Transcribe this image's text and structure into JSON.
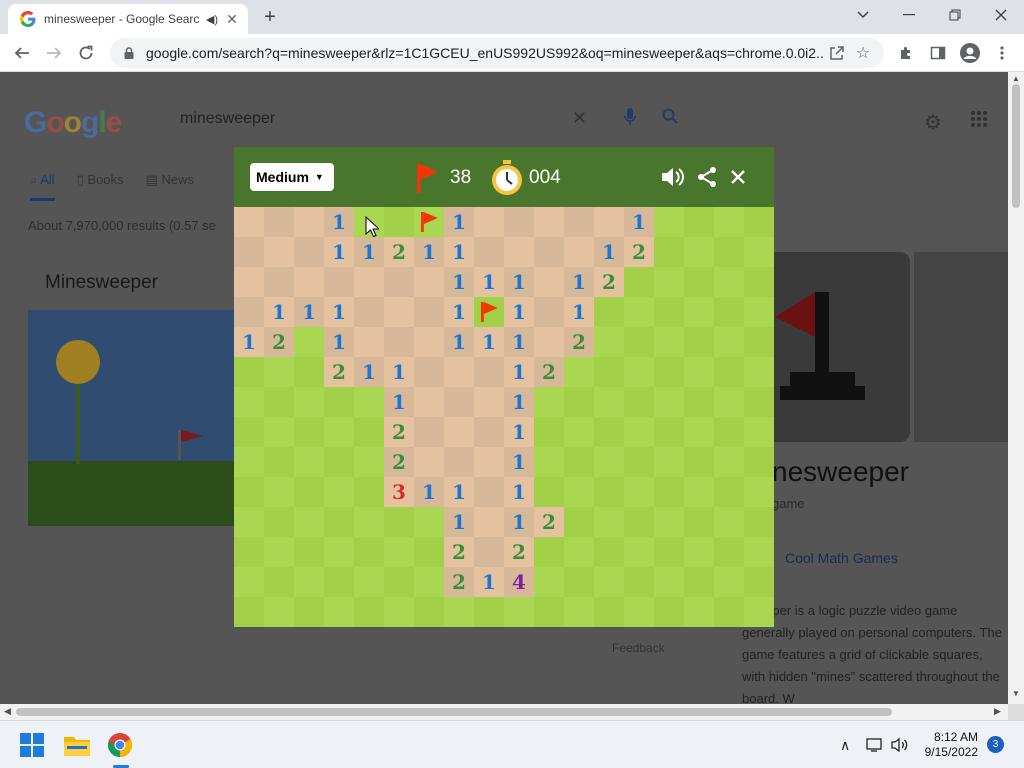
{
  "browser": {
    "tab_title": "minesweeper - Google Search",
    "url": "google.com/search?q=minesweeper&rlz=1C1GCEU_enUS992US992&oq=minesweeper&aqs=chrome.0.0i2..."
  },
  "google": {
    "query": "minesweeper",
    "tabs": [
      {
        "label": "All"
      },
      {
        "label": "Books"
      },
      {
        "label": "News"
      }
    ],
    "stats": "About 7,970,000 results (0.57 se",
    "heading": "Minesweeper",
    "kp_title": "nesweeper",
    "kp_subtitle": "game",
    "kp_link": "Cool Math Games",
    "kp_desc": "sweeper is a logic puzzle video game generally played on personal computers. The game features a grid of clickable squares, with hidden \"mines\" scattered throughout the board. W",
    "feedback": "Feedback"
  },
  "game": {
    "difficulty": "Medium",
    "flags_remaining": "38",
    "timer": "004",
    "cols": 18,
    "rows": 14,
    "colors": {
      "header": "#4a752c",
      "hidden_light": "#aad751",
      "hidden_dark": "#a2d149",
      "revealed_light": "#e5c29f",
      "revealed_dark": "#d7b899",
      "flag": "#f23607"
    },
    "board": [
      "RRR1HHF1RRRRR1HHHH",
      "RRR11211RRRR12HHHH",
      "RRRRRRR111R12HHHHH",
      "R111RRR1F1R1HHHHHH",
      "12H1RRR111R2HHHHHH",
      "HHH211RRR12HHHHHHH",
      "HHHHH1RRR1HHHHHHHH",
      "HHHHH2RRR1HHHHHHHH",
      "HHHHH2RRR1HHHHHHHH",
      "HHHHH311R1HHHHHHHH",
      "HHHHHHH1R12HHHHHHH",
      "HHHHHHH2R2HHHHHHHH",
      "HHHHHHH214HHHHHHHH",
      "HHHHHHHHHHHHHHHHHH"
    ]
  },
  "taskbar": {
    "time": "8:12 AM",
    "date": "9/15/2022",
    "notifications": "3"
  }
}
